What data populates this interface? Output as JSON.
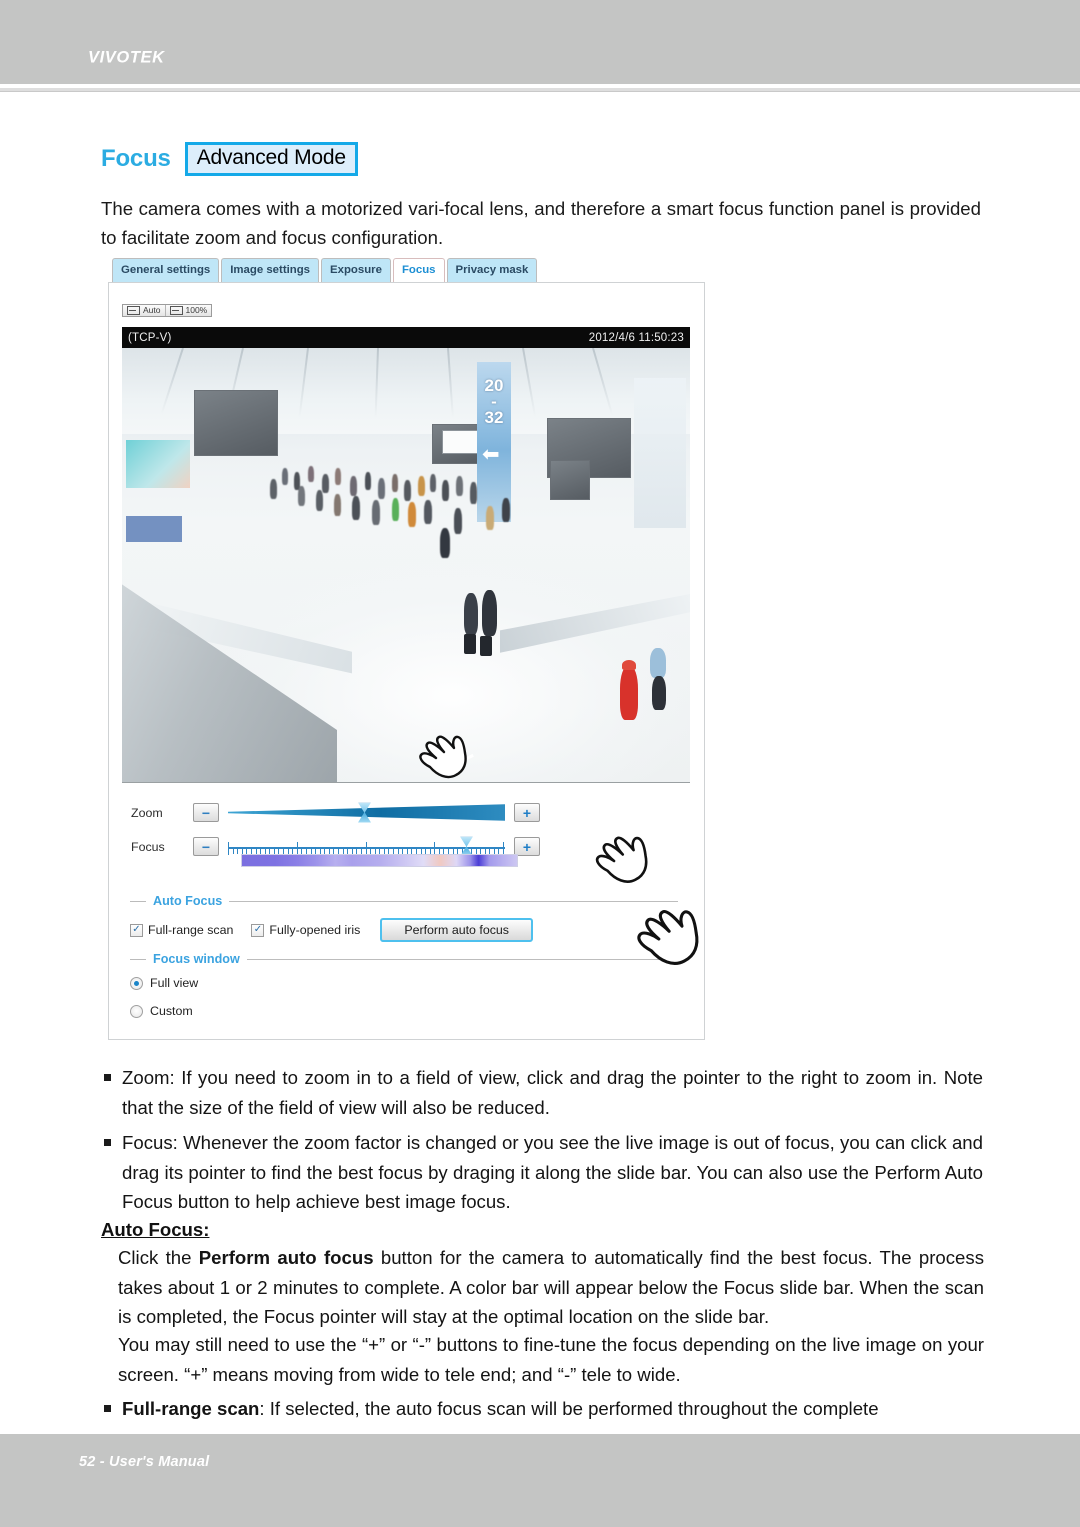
{
  "header": {
    "brand": "VIVOTEK"
  },
  "section": {
    "title": "Focus",
    "mode_badge": "Advanced Mode",
    "intro": "The camera comes with a motorized vari-focal lens, and therefore a smart focus function panel is provided to facilitate zoom and focus configuration."
  },
  "screenshot": {
    "tabs": [
      {
        "label": "General settings",
        "active": false
      },
      {
        "label": "Image settings",
        "active": false
      },
      {
        "label": "Exposure",
        "active": false
      },
      {
        "label": "Focus",
        "active": true
      },
      {
        "label": "Privacy mask",
        "active": false
      }
    ],
    "view_size": {
      "auto_label": "Auto",
      "percent_label": "100%"
    },
    "video": {
      "protocol": "(TCP-V)",
      "timestamp": "2012/4/6 11:50:23",
      "scene_description": "airport terminal concourse with travellers"
    },
    "zoom": {
      "label": "Zoom",
      "minus_label": "−",
      "plus_label": "+",
      "handle_percent": 49
    },
    "focus": {
      "label": "Focus",
      "minus_label": "−",
      "plus_label": "+",
      "handle_percent": 86
    },
    "auto_focus": {
      "title": "Auto Focus",
      "full_range_scan": "Full-range scan",
      "full_range_scan_checked": "✓",
      "fully_opened_iris": "Fully-opened iris",
      "fully_opened_iris_checked": "✓",
      "perform_button": "Perform auto focus"
    },
    "focus_window": {
      "title": "Focus window",
      "options": [
        {
          "label": "Full view",
          "selected": true
        },
        {
          "label": "Custom",
          "selected": false
        }
      ]
    }
  },
  "body": {
    "bullet_zoom": "Zoom: If you need to zoom in to a field of view, click and drag the pointer to the right to zoom in. Note that the size of the field of view will also be reduced.",
    "bullet_focus": "Focus: Whenever the zoom factor is changed or you see the live image is out of focus, you can click and drag its pointer to find the best focus by draging it along the slide bar. You can also use the Perform Auto Focus button to help achieve best image focus.",
    "auto_focus_heading": "Auto Focus:",
    "auto_focus_p1_a": "Click the ",
    "auto_focus_p1_b": "Perform auto focus",
    "auto_focus_p1_c": " button for the camera to automatically find the best focus. The process takes about 1 or 2 minutes to complete. A color bar will appear below the Focus slide bar. When the scan is completed, the Focus pointer will stay at the optimal location on the slide bar.",
    "auto_focus_p2": "You may still need to use the “+” or “-” buttons to fine-tune the focus depending on the live image on your screen. “+” means moving from wide to tele end; and “-” tele to wide.",
    "bullet_fullrange_b": "Full-range scan",
    "bullet_fullrange_rest": ": If selected, the auto focus scan will be performed throughout the complete"
  },
  "footer": {
    "text": "52 - User's Manual"
  }
}
